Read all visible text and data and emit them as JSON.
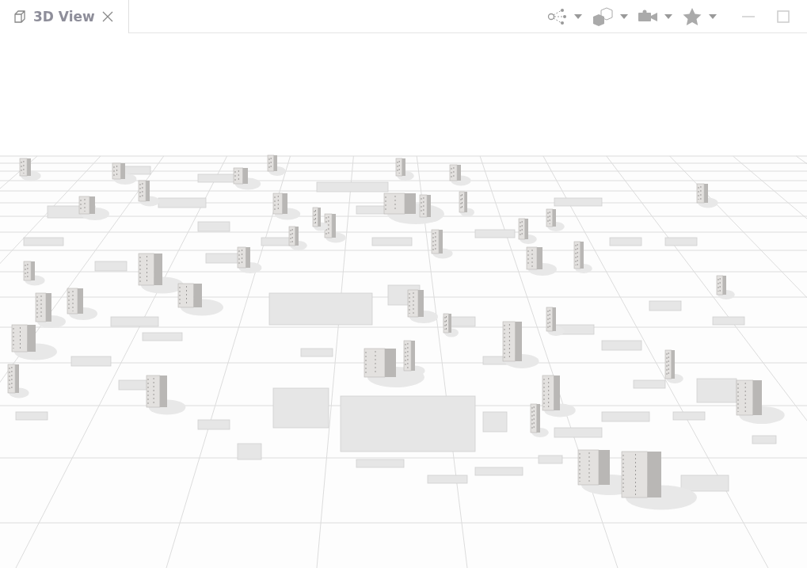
{
  "tab": {
    "label": "3D View",
    "selected": true
  }
}
